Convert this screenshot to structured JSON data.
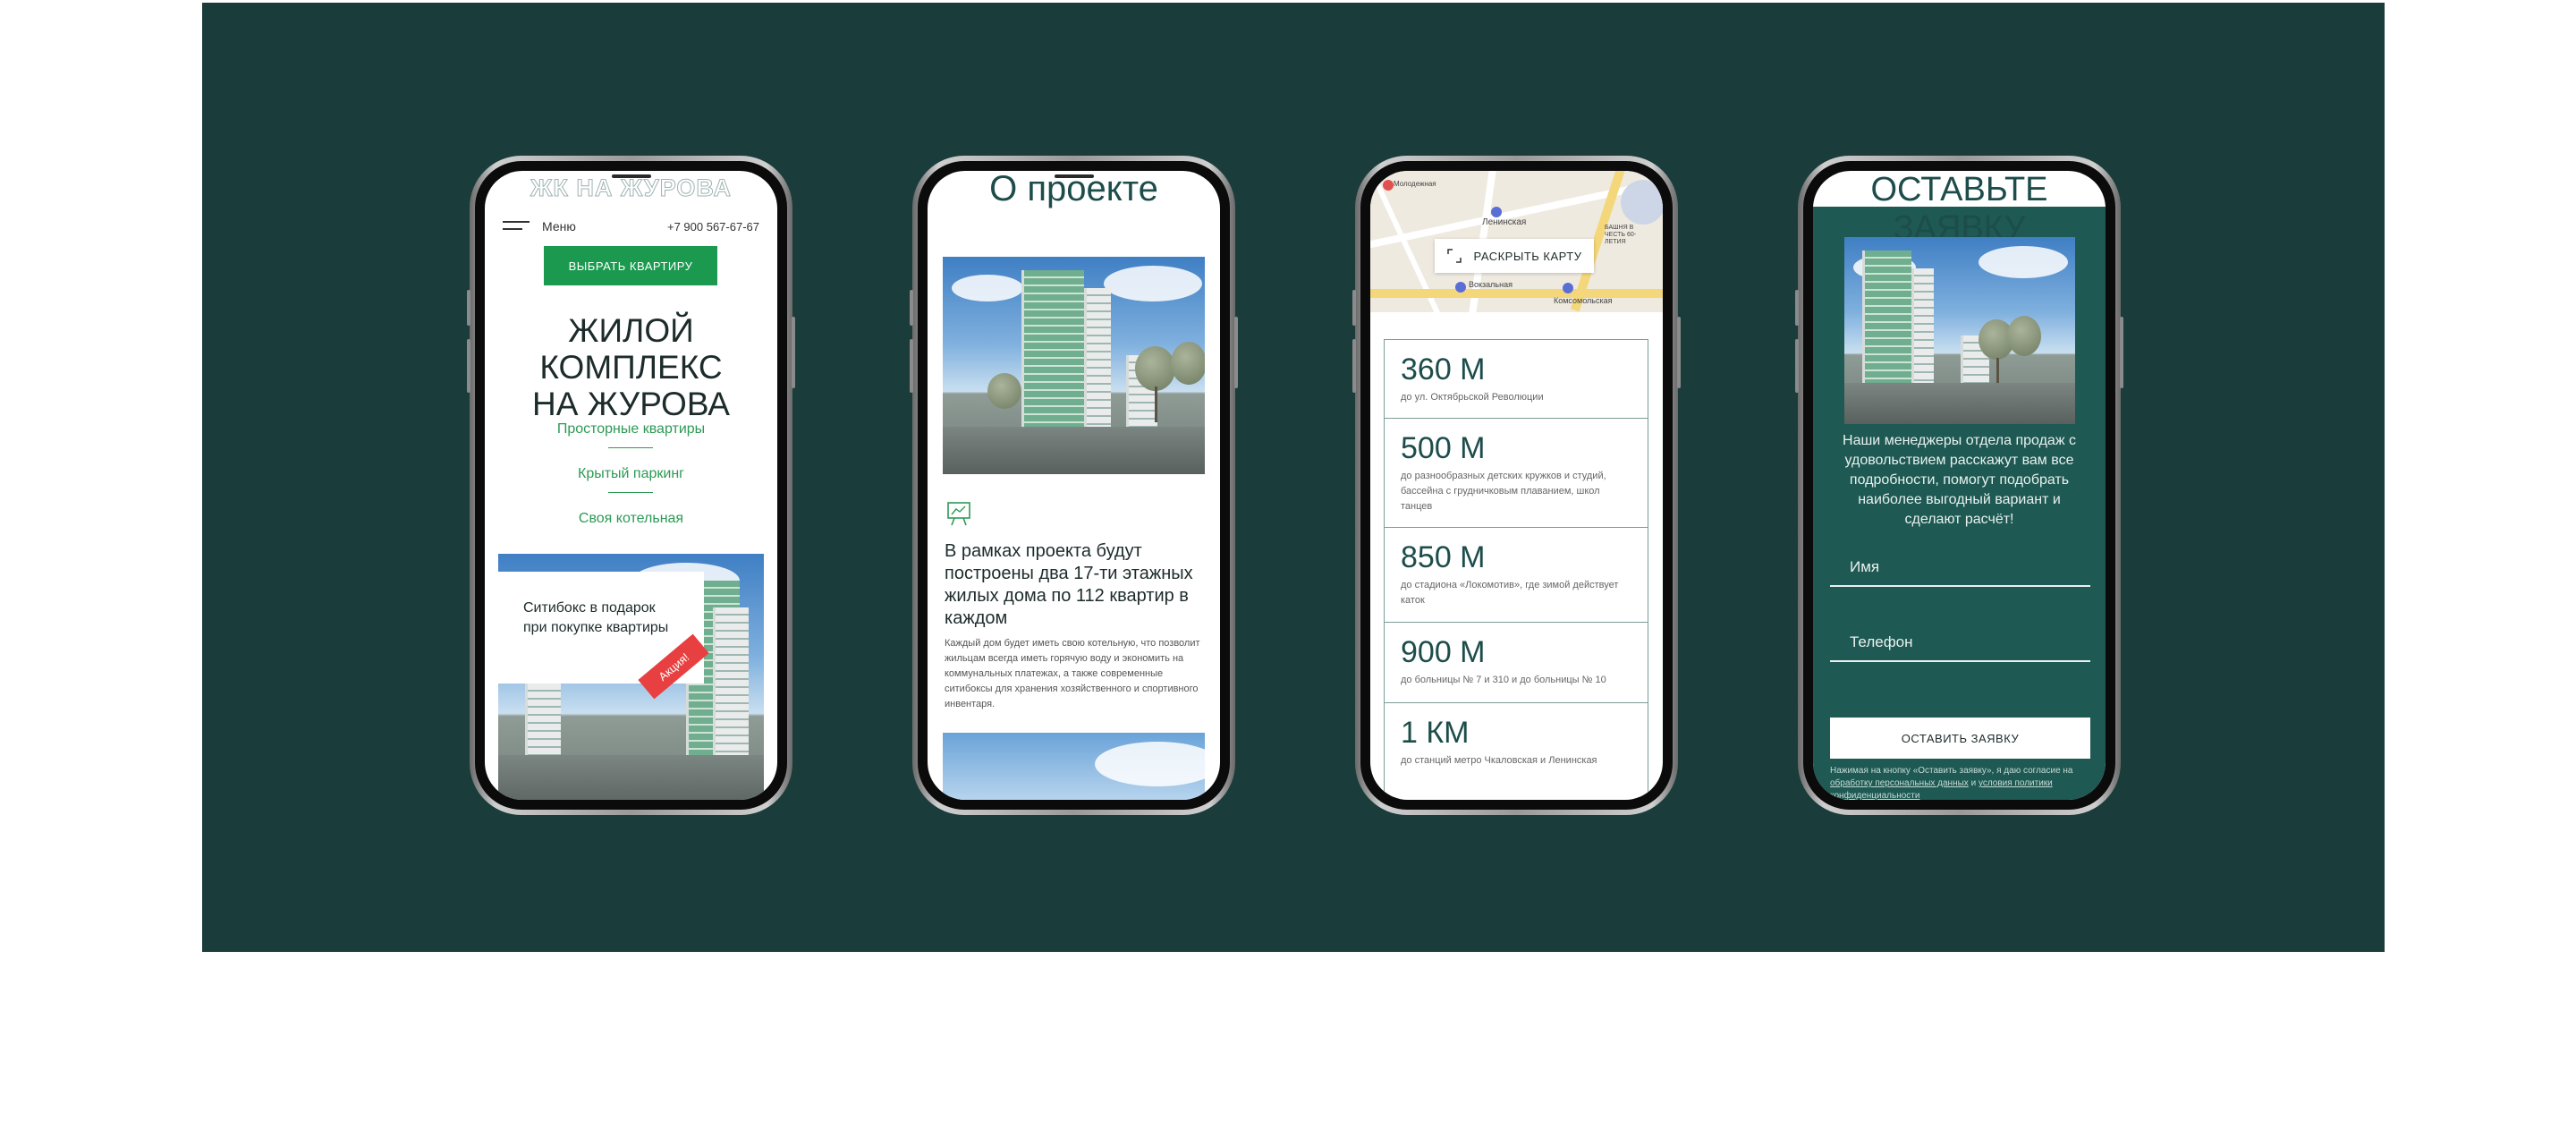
{
  "colors": {
    "background_panel": "#1a3c3b",
    "accent_green": "#1b9a4f",
    "feature_green": "#2c9a54",
    "teal_dark": "#1d4d4b",
    "form_panel": "#1e5953"
  },
  "phone1": {
    "title": "ЖК НА ЖУРОВА",
    "menu_label": "Меню",
    "phone_number": "+7 900 567-67-67",
    "cta_label": "ВЫБРАТЬ КВАРТИРУ",
    "heading_line1": "ЖИЛОЙ КОМПЛЕКС",
    "heading_line2": "НА ЖУРОВА",
    "features": [
      "Просторные квартиры",
      "Крытый паркинг",
      "Своя котельная"
    ],
    "promo_line1": "Ситибокс в подарок",
    "promo_line2": "при покупке квартиры",
    "promo_badge": "Акция!"
  },
  "phone2": {
    "title": "О проекте",
    "heading": "В рамках проекта будут построены два 17-ти этажных жилых дома по 112 квартир в каждом",
    "paragraph": "Каждый дом будет иметь свою котельную, что позволит жильцам всегда иметь горячую воду и экономить на коммунальных платежах, а также современные ситибоксы для хранения хозяйственного и спортивного инвентаря."
  },
  "phone3": {
    "map_button": "РАСКРЫТЬ КАРТУ",
    "map_labels": [
      "Ленинская",
      "Комсомольская",
      "Вокзальная",
      "Молодежная",
      "БАШНЯ В ЧЕСТЬ 60-ЛЕТИЯ"
    ],
    "distances": [
      {
        "value": "360 М",
        "description": "до ул. Октябрьской Революции"
      },
      {
        "value": "500 М",
        "description": "до разнообразных детских кружков и студий, бассейна с грудничковым плаванием, школ танцев"
      },
      {
        "value": "850 М",
        "description": "до стадиона «Локомотив», где зимой действует каток"
      },
      {
        "value": "900 М",
        "description": "до больницы № 7 и 310 и до больницы № 10"
      },
      {
        "value": "1 КМ",
        "description": "до станций метро Чкаловская и Ленинская"
      }
    ]
  },
  "phone4": {
    "title": "ОСТАВЬТЕ ЗАЯВКУ",
    "description": "Наши менеджеры отдела продаж с удовольствием расскажут вам все подробности, помогут подобрать наиболее выгодный вариант и сделают расчёт!",
    "name_placeholder": "Имя",
    "phone_placeholder": "Телефон",
    "submit_label": "ОСТАВИТЬ ЗАЯВКУ",
    "consent_prefix": "Нажимая на кнопку «Оставить заявку», я даю согласие на",
    "consent_link1": "обработку персональных данных",
    "consent_and": "и",
    "consent_link2": "условия политики конфиденциальности"
  }
}
